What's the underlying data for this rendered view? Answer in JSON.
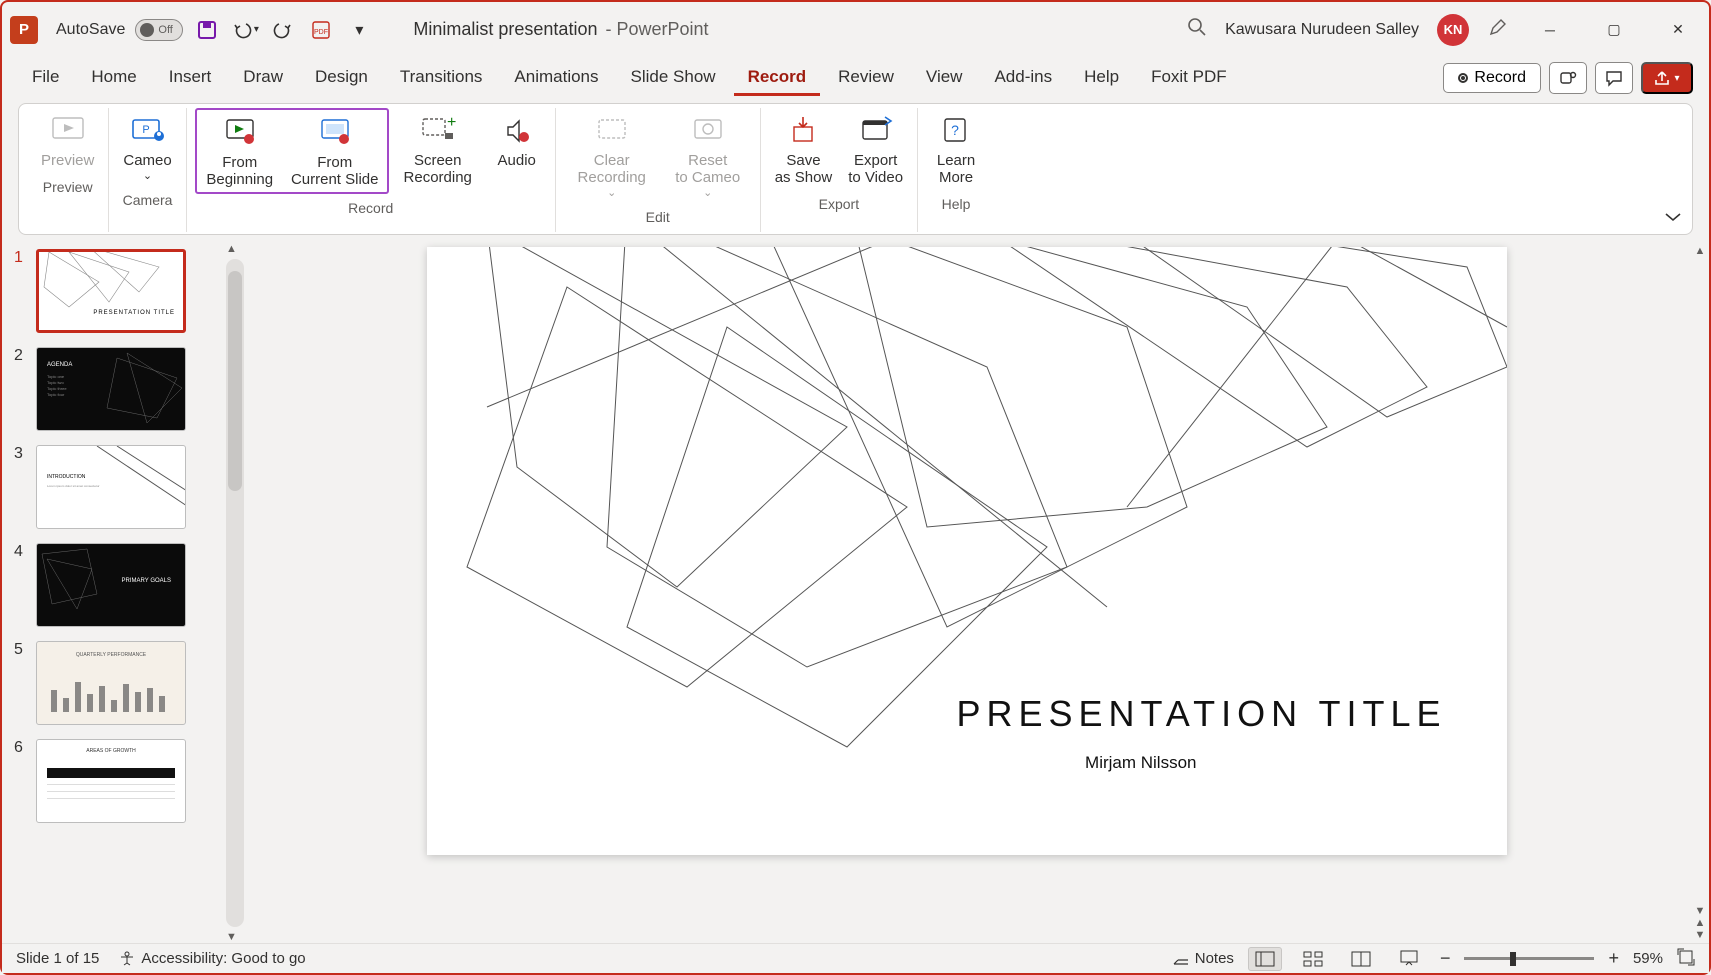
{
  "title_bar": {
    "autosave_label": "AutoSave",
    "autosave_state": "Off",
    "doc_name": "Minimalist presentation",
    "app_suffix": "- PowerPoint",
    "user_name": "Kawusara Nurudeen Salley",
    "user_initials": "KN"
  },
  "tabs": [
    "File",
    "Home",
    "Insert",
    "Draw",
    "Design",
    "Transitions",
    "Animations",
    "Slide Show",
    "Record",
    "Review",
    "View",
    "Add-ins",
    "Help",
    "Foxit PDF"
  ],
  "active_tab": "Record",
  "record_button": "Record",
  "ribbon": {
    "groups": [
      {
        "name": "Preview",
        "label": "Preview",
        "items": [
          {
            "id": "preview",
            "label": "Preview",
            "disabled": true
          }
        ]
      },
      {
        "name": "Camera",
        "label": "Camera",
        "items": [
          {
            "id": "cameo",
            "label": "Cameo",
            "dropdown": true
          }
        ]
      },
      {
        "name": "Record",
        "label": "Record",
        "highlight": true,
        "items": [
          {
            "id": "from-beginning",
            "label": "From Beginning"
          },
          {
            "id": "from-current",
            "label": "From Current Slide"
          }
        ],
        "extra": [
          {
            "id": "screen-recording",
            "label": "Screen Recording"
          },
          {
            "id": "audio",
            "label": "Audio"
          }
        ]
      },
      {
        "name": "Edit",
        "label": "Edit",
        "items": [
          {
            "id": "clear-recording",
            "label": "Clear Recording",
            "dropdown": true,
            "disabled": true
          },
          {
            "id": "reset-cameo",
            "label": "Reset to Cameo",
            "dropdown": true,
            "disabled": true
          }
        ]
      },
      {
        "name": "Export",
        "label": "Export",
        "items": [
          {
            "id": "save-as-show",
            "label": "Save as Show"
          },
          {
            "id": "export-video",
            "label": "Export to Video"
          }
        ]
      },
      {
        "name": "Help",
        "label": "Help",
        "items": [
          {
            "id": "learn-more",
            "label": "Learn More"
          }
        ]
      }
    ]
  },
  "thumbnails": [
    {
      "n": 1,
      "selected": true,
      "bg": "white",
      "caption": "PRESENTATION TITLE"
    },
    {
      "n": 2,
      "bg": "dark",
      "caption": "AGENDA"
    },
    {
      "n": 3,
      "bg": "white",
      "caption": "INTRODUCTION"
    },
    {
      "n": 4,
      "bg": "dark",
      "caption": "PRIMARY GOALS"
    },
    {
      "n": 5,
      "bg": "beige",
      "caption": "QUARTERLY PERFORMANCE"
    },
    {
      "n": 6,
      "bg": "white",
      "caption": "AREAS OF GROWTH"
    }
  ],
  "slide": {
    "title": "PRESENTATION TITLE",
    "subtitle": "Mirjam Nilsson"
  },
  "status": {
    "slide_counter": "Slide 1 of 15",
    "accessibility": "Accessibility: Good to go",
    "notes_label": "Notes",
    "zoom_pct": "59%"
  }
}
